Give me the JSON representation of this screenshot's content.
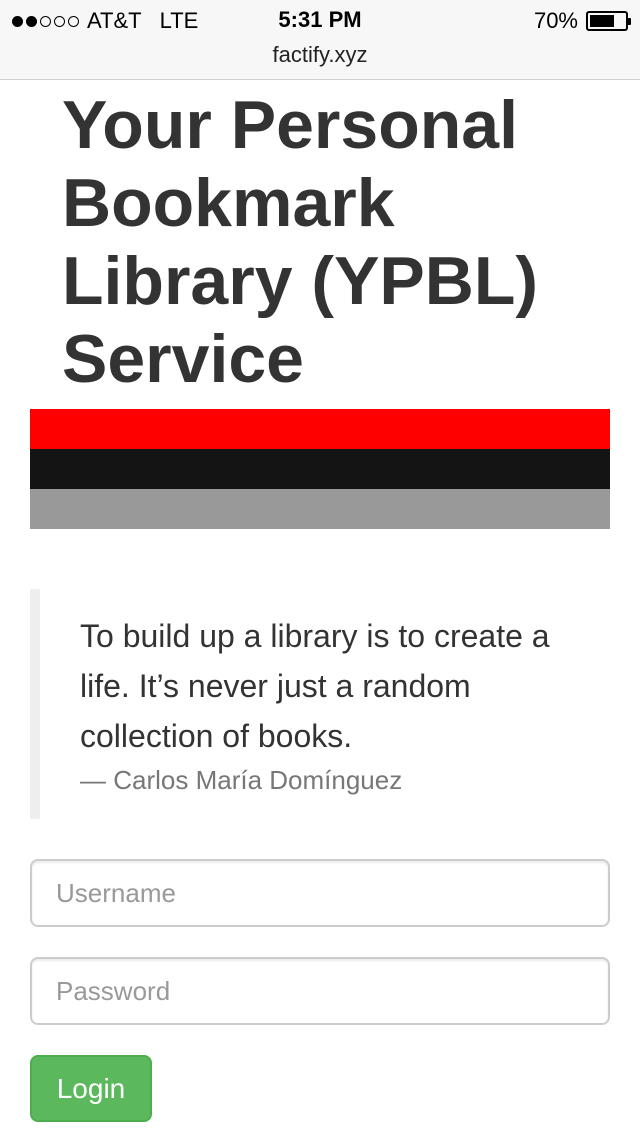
{
  "status_bar": {
    "signal_bars": 2,
    "signal_total": 5,
    "carrier": "AT&T",
    "network": "LTE",
    "time": "5:31 PM",
    "battery_percent_label": "70%",
    "battery_level": 0.7,
    "url": "factify.xyz"
  },
  "page": {
    "title": "Your Personal Bookmark Library (YPBL) Service",
    "stripe_colors": [
      "#ff0000",
      "#141414",
      "#999999"
    ],
    "quote": {
      "text": "To build up a library is to create a life. It’s never just a random collection of books.",
      "author": "— Carlos María Domínguez"
    },
    "form": {
      "username_placeholder": "Username",
      "password_placeholder": "Password",
      "login_label": "Login"
    },
    "colors": {
      "login_button": "#5cb85c",
      "heading_text": "#333333"
    }
  }
}
